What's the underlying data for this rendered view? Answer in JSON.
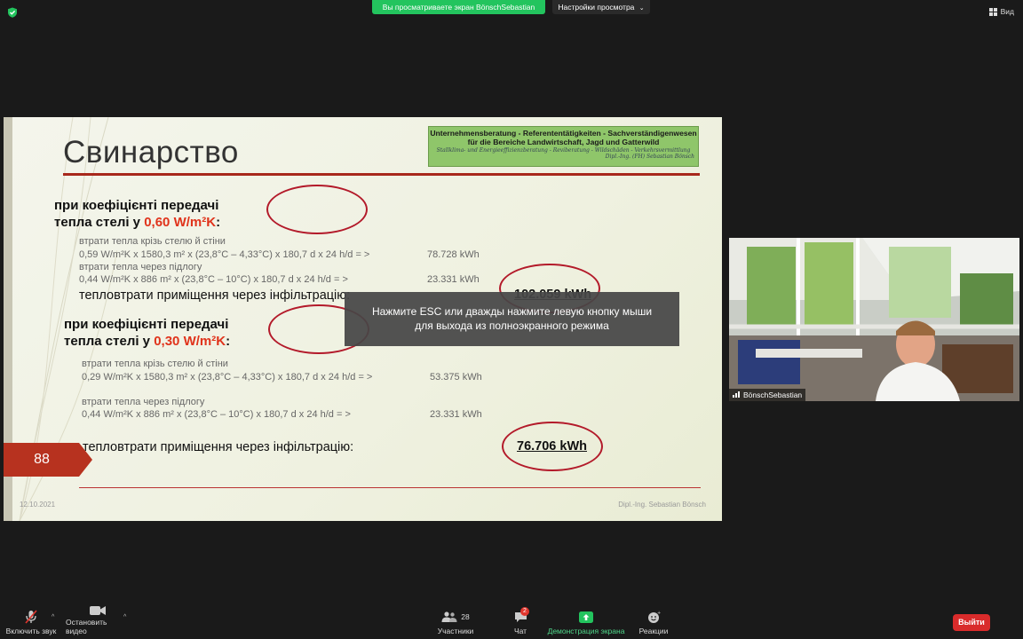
{
  "top_bar": {
    "share_banner": "Вы просматриваете экран BönschSebastian",
    "view_settings": "Настройки просмотра",
    "view_label": "Вид"
  },
  "slide": {
    "title": "Свинарство",
    "logo": {
      "line1": "Unternehmensberatung  -  Referententätigkeiten  -  Sachverständigenwesen",
      "line2": "für die Bereiche Landwirtschaft, Jagd und Gatterwild",
      "line3": "Stallklima- und Energieeffizienzberatung - Reviberatung - Wildschäden - Verkehrsvermittlung",
      "line4": "Dipl.-Ing. (FH) Sebastian Bönsch"
    },
    "section1": {
      "heading_line1": "при коефіцієнті передачі",
      "heading_line2_prefix": "тепла стелі у ",
      "heading_value": "0,60 W/m²K",
      "heading_suffix": ":",
      "loss_ceiling_label": "втрати тепла крізь стелю й стіни",
      "loss_ceiling_formula": "0,59 W/m²K x 1580,3 m² x (23,8°C – 4,33°C)  x 180,7 d  x 24 h/d = >",
      "loss_ceiling_value": "78.728 kWh",
      "loss_floor_label": "втрати тепла через підлогу",
      "loss_floor_formula": "0,44 W/m²K x 886 m² x (23,8°C – 10°C)  x 180,7 d  x 24 h/d = >",
      "loss_floor_value": "23.331 kWh",
      "total_label": "тепловтрати приміщення через інфільтрацію:",
      "total_value": "102.059 kWh"
    },
    "section2": {
      "heading_line1": "при коефіцієнті передачі",
      "heading_line2_prefix": "тепла стелі у ",
      "heading_value": "0,30 W/m²K",
      "heading_suffix": ":",
      "loss_ceiling_label": "втрати тепла крізь стелю й стіни",
      "loss_ceiling_formula": "0,29 W/m²K x 1580,3 m² x (23,8°C – 4,33°C)  x 180,7 d  x 24 h/d = >",
      "loss_ceiling_value": "53.375 kWh",
      "loss_floor_label": "втрати тепла через підлогу",
      "loss_floor_formula": "0,44 W/m²K x 886 m² x (23,8°C – 10°C)  x 180,7 d  x 24 h/d = >",
      "loss_floor_value": "23.331 kWh",
      "total_label": "тепловтрати приміщення через інфільтрацію:",
      "total_value": "76.706 kWh"
    },
    "page_number": "88",
    "date": "12.10.2021",
    "author": "Dipl.-Ing. Sebastian Bönsch"
  },
  "overlay": {
    "esc_line1": "Нажмите ESC или дважды нажмите левую кнопку мыши",
    "esc_line2": "для выхода из полноэкранного режима"
  },
  "video": {
    "participant_name": "BönschSebastian"
  },
  "toolbar": {
    "audio_label": "Включить звук",
    "video_label": "Остановить видео",
    "participants_label": "Участники",
    "participants_count": "28",
    "chat_label": "Чат",
    "chat_badge": "2",
    "share_label": "Демонстрация экрана",
    "reactions_label": "Реакции",
    "leave_label": "Выйти"
  },
  "colors": {
    "accent_green": "#23c45e",
    "slide_red": "#b7321f",
    "leave_red": "#d92b2b"
  }
}
